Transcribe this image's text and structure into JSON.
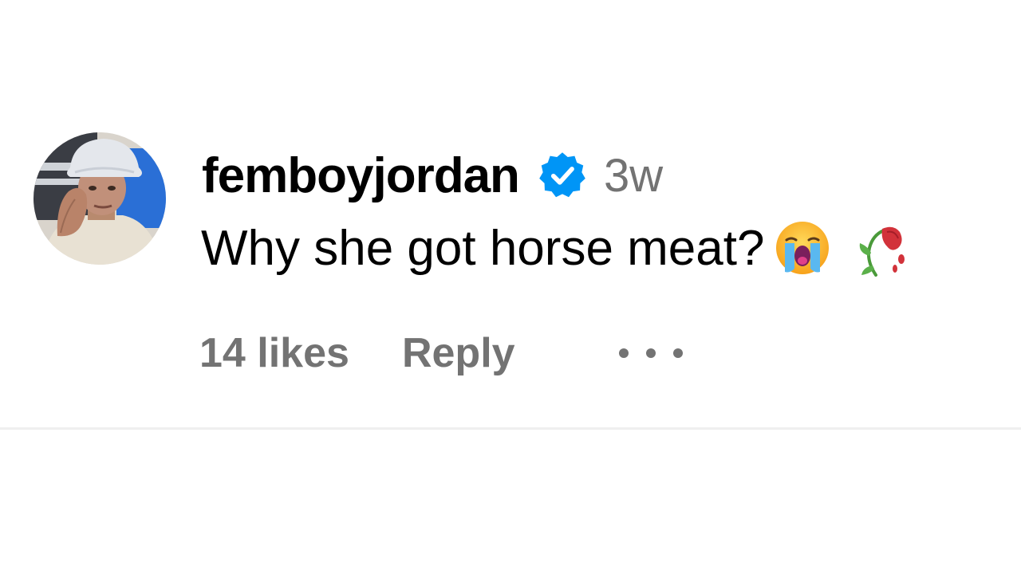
{
  "comment": {
    "username": "femboyjordan",
    "verified": true,
    "timestamp": "3w",
    "text": "Why she got horse meat?",
    "emojis": [
      "loudly-crying-face-emoji",
      "wilted-flower-emoji"
    ],
    "likes_label": "14 likes",
    "reply_label": "Reply",
    "more_icon": "more-horizontal-icon"
  },
  "colors": {
    "verified_badge": "#0095f6",
    "muted_text": "#737373",
    "primary_text": "#000000",
    "divider": "#efefef"
  }
}
